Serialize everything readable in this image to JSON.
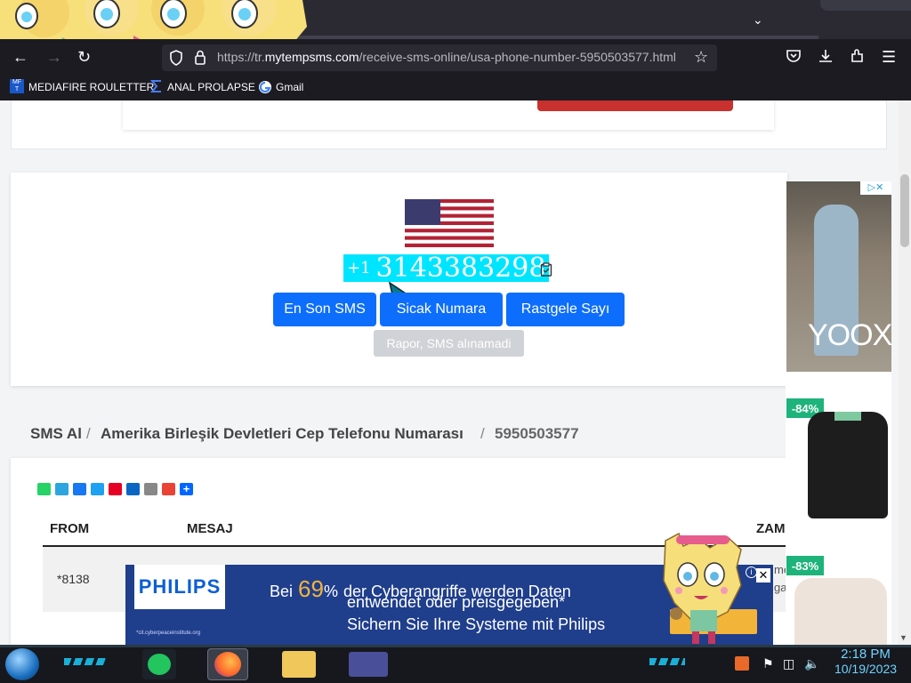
{
  "browser": {
    "url_prefix": "https://tr.",
    "url_domain": "mytempsms.com",
    "url_path": "/receive-sms-online/usa-phone-number-5950503577.html",
    "bookmarks": [
      {
        "label": "MEDIAFIRE ROULETTER",
        "icon": "mediafire-icon"
      },
      {
        "label": "ANAL PROLAPSE",
        "icon": "sigma-icon"
      },
      {
        "label": "Gmail",
        "icon": "google-icon"
      }
    ],
    "accent": "#0d6efd"
  },
  "phone": {
    "country_code": "+1",
    "number": "3143383298",
    "highlight_color": "#00e5ff"
  },
  "actions": {
    "latest_sms": "En Son SMS",
    "hot_number": "Sicak Numara",
    "random_number": "Rastgele Sayı",
    "report": "Rapor, SMS alınamadi"
  },
  "breadcrumb": {
    "home": "SMS Al",
    "country": "Amerika Birleşik Devletleri Cep Telefonu Numarası",
    "number": "5950503577",
    "separator": "/"
  },
  "table": {
    "headers": {
      "from": "FROM",
      "message": "MESAJ",
      "time": "ZAM"
    },
    "rows": [
      {
        "from": "*8138",
        "time_a": "me",
        "time_b": "ga"
      }
    ]
  },
  "ad_bottom": {
    "brand": "PHILIPS",
    "line1_pre": "Bei",
    "percent": "69",
    "percent_sign": "%",
    "line1_post": "der Cyberangriffe werden Daten",
    "line2": "entwendet oder preisgegeben*",
    "line3": "Sichern Sie Ihre Systeme mit Philips",
    "source": "*cit.cyberpeaceinstitute.org"
  },
  "ad_side": {
    "brand": "YOOX",
    "discounts": [
      "-84%",
      "-83%"
    ]
  },
  "taskbar": {
    "time": "2:18 PM",
    "date": "10/19/2023"
  }
}
